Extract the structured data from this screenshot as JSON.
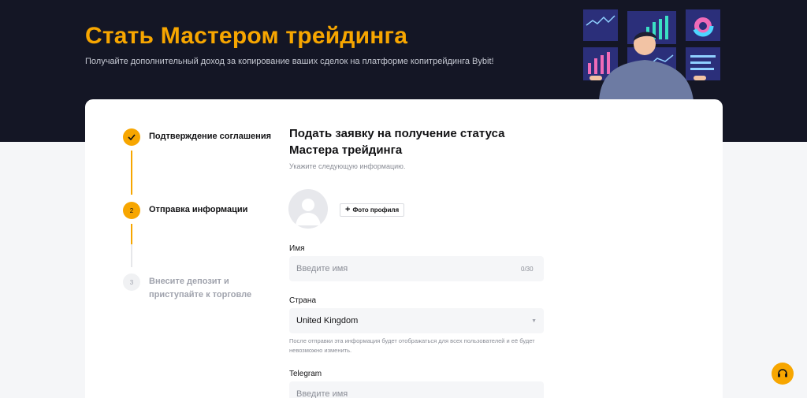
{
  "hero": {
    "title": "Стать Мастером трейдинга",
    "subtitle": "Получайте дополнительный доход за копирование ваших сделок на платформе копитрейдинга Bybit!"
  },
  "steps": [
    {
      "number": "1",
      "label": "Подтверждение соглашения",
      "status": "completed"
    },
    {
      "number": "2",
      "label": "Отправка информации",
      "status": "current"
    },
    {
      "number": "3",
      "label": "Внесите депозит и приступайте к торговле",
      "status": "pending"
    }
  ],
  "form": {
    "title": "Подать заявку на получение статуса Мастера трейдинга",
    "subtitle": "Укажите следующую информацию.",
    "photo_button": "Фото профиля",
    "name": {
      "label": "Имя",
      "placeholder": "Введите имя",
      "counter": "0/30"
    },
    "country": {
      "label": "Страна",
      "value": "United Kingdom",
      "hint": "После отправки эта информация будет отображаться для всех пользователей и её будет невозможно изменить."
    },
    "telegram": {
      "label": "Telegram",
      "placeholder": "Введите имя"
    }
  },
  "colors": {
    "accent": "#f7a600",
    "hero_bg": "#141625"
  },
  "icons": {
    "check": "check-icon",
    "plus": "plus-icon",
    "caret": "caret-down-icon",
    "support": "headset-icon"
  }
}
